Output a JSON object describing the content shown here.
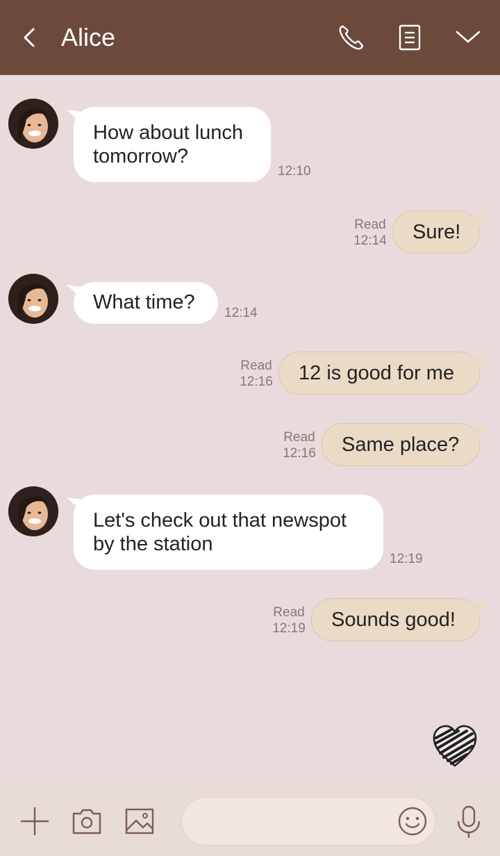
{
  "header": {
    "title": "Alice",
    "icons": [
      "back-icon",
      "phone-icon",
      "notes-icon",
      "chevron-down-icon"
    ],
    "bg_color": "#6b4a3c"
  },
  "messages": [
    {
      "side": "in",
      "text": "How about lunch\ntomorrow?",
      "time": "12:10"
    },
    {
      "side": "out",
      "text": "Sure!",
      "read": "Read",
      "time": "12:14"
    },
    {
      "side": "in",
      "text": "What time?",
      "time": "12:14"
    },
    {
      "side": "out",
      "text": "12 is good for me",
      "read": "Read",
      "time": "12:16"
    },
    {
      "side": "out",
      "text": "Same place?",
      "read": "Read",
      "time": "12:16"
    },
    {
      "side": "in",
      "text": "Let's check out that newspot\nby the station",
      "time": "12:19"
    },
    {
      "side": "out",
      "text": "Sounds good!",
      "read": "Read",
      "time": "12:19"
    }
  ],
  "footer": {
    "input_value": "",
    "input_placeholder": "",
    "icons": [
      "plus-icon",
      "camera-icon",
      "image-icon",
      "emoji-icon",
      "microphone-icon"
    ]
  },
  "colors": {
    "background": "#e9dbdb",
    "incoming_bubble": "#ffffff",
    "outgoing_bubble": "#eadac6",
    "meta_text": "#8a7670"
  }
}
